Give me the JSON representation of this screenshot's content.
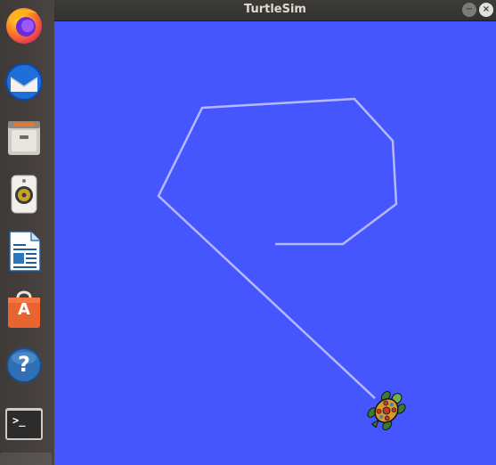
{
  "window": {
    "title": "TurtleSim",
    "minimize_symbol": "−",
    "close_symbol": "×"
  },
  "dock": {
    "items": [
      {
        "name": "Firefox",
        "icon": "firefox-icon"
      },
      {
        "name": "Thunderbird",
        "icon": "thunderbird-icon"
      },
      {
        "name": "Files",
        "icon": "files-icon"
      },
      {
        "name": "Rhythmbox",
        "icon": "rhythmbox-icon"
      },
      {
        "name": "LibreOffice Writer",
        "icon": "writer-icon"
      },
      {
        "name": "Ubuntu Software",
        "icon": "software-icon"
      },
      {
        "name": "Help",
        "icon": "help-icon"
      },
      {
        "name": "Terminal",
        "icon": "terminal-icon"
      }
    ]
  },
  "turtlesim": {
    "background_color": "#4556ff",
    "pen_color": "#b3b8ff",
    "turtle_icon": "turtle-icon"
  },
  "dock_glyphs": {
    "help": "?",
    "software": "A",
    "terminal_prompt": ">_"
  }
}
